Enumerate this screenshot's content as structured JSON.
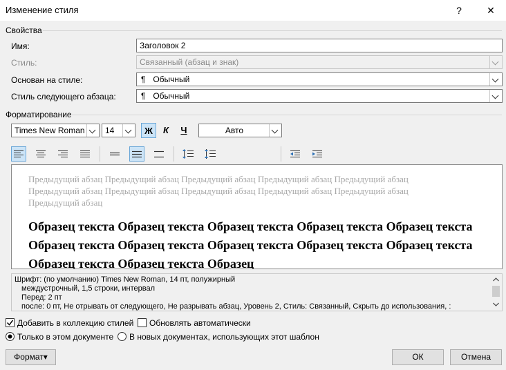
{
  "window": {
    "title": "Изменение стиля",
    "help": "?",
    "close": "✕"
  },
  "properties": {
    "group_label": "Свойства",
    "name_label": "Имя:",
    "name_value": "Заголовок 2",
    "style_label": "Стиль:",
    "style_value": "Связанный (абзац и знак)",
    "based_on_label": "Основан на стиле:",
    "based_on_value": "Обычный",
    "next_label": "Стиль следующего абзаца:",
    "next_value": "Обычный",
    "pilcrow": "¶"
  },
  "formatting": {
    "group_label": "Форматирование",
    "font_name": "Times New Roman",
    "font_size": "14",
    "bold": "Ж",
    "italic": "К",
    "underline": "Ч",
    "color": "Авто"
  },
  "preview": {
    "previous_paragraph": "Предыдущий абзац Предыдущий абзац Предыдущий абзац Предыдущий абзац Предыдущий абзац Предыдущий абзац Предыдущий абзац Предыдущий абзац Предыдущий абзац Предыдущий абзац Предыдущий абзац",
    "sample": "Образец текста Образец текста Образец текста Образец текста Образец текста Образец текста Образец текста Образец текста Образец текста Образец текста Образец текста Образец текста Образец"
  },
  "description": {
    "line1": "Шрифт: (по умолчанию) Times New Roman, 14 пт, полужирный",
    "line2": "междустрочный,  1,5 строки, интервал",
    "line3": "Перед:  2 пт",
    "line4": "после: 0 пт, Не отрывать от следующего, Не разрывать абзац, Уровень 2, Стиль: Связанный, Скрыть до использования, :"
  },
  "options": {
    "add_to_gallery": "Добавить в коллекцию стилей",
    "add_to_gallery_checked": true,
    "auto_update": "Обновлять автоматически",
    "auto_update_checked": false,
    "only_this_doc": "Только в этом документе",
    "new_docs": "В новых документах, использующих этот шаблон"
  },
  "buttons": {
    "format": "Формат",
    "format_arrow": "▾",
    "ok": "ОК",
    "cancel": "Отмена"
  }
}
